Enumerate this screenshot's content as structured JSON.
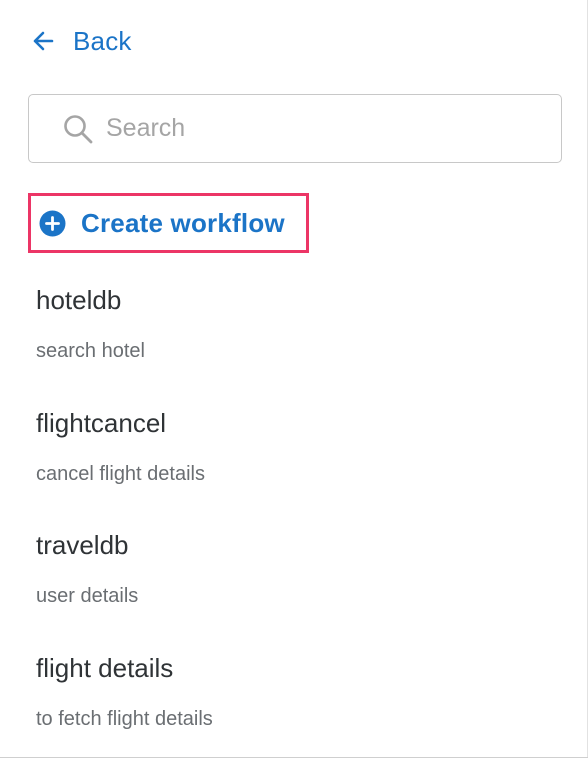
{
  "nav": {
    "back_label": "Back",
    "back_icon": "arrow-left-icon"
  },
  "search": {
    "placeholder": "Search",
    "value": "",
    "icon": "search-icon"
  },
  "create_workflow": {
    "label": "Create workflow",
    "icon": "plus-circle-icon"
  },
  "workflows": [
    {
      "name": "hoteldb",
      "description": "search hotel"
    },
    {
      "name": "flightcancel",
      "description": "cancel flight details"
    },
    {
      "name": "traveldb",
      "description": "user details"
    },
    {
      "name": "flight details",
      "description": "to fetch flight details"
    }
  ],
  "colors": {
    "accent": "#1b74c7",
    "highlight": "#ec3566",
    "name_text": "#2f3336",
    "desc_text": "#6a6e72"
  }
}
